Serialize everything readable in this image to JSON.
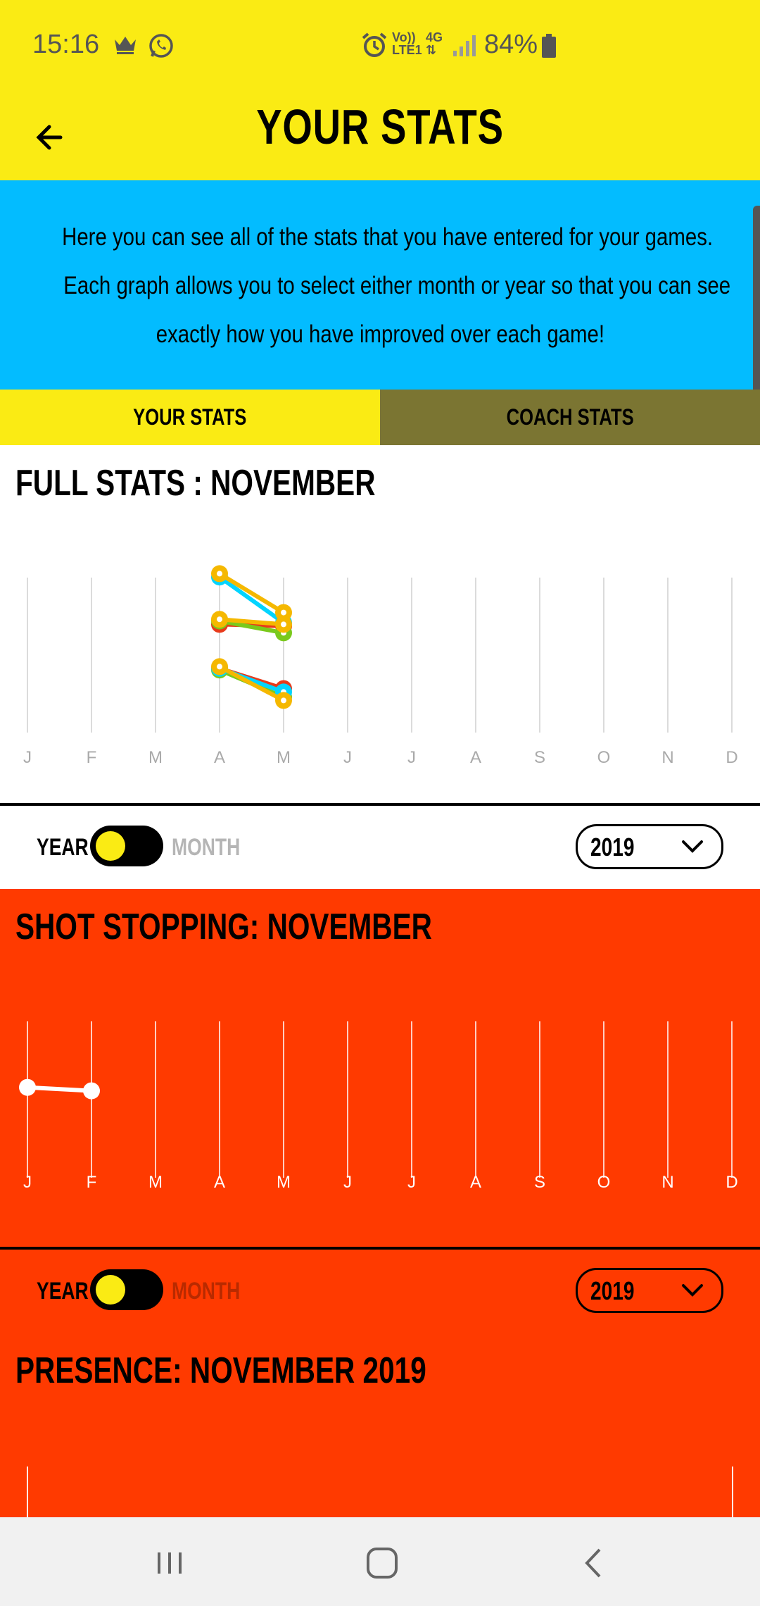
{
  "status_bar": {
    "time": "15:16",
    "icons": [
      "crown-icon",
      "whatsapp-icon",
      "alarm-icon",
      "volte-icon",
      "4g-icon",
      "signal-icon",
      "battery-icon"
    ],
    "volte_line1": "Vo))",
    "volte_line2": "LTE1",
    "network": "4G",
    "battery": "84%"
  },
  "app_bar": {
    "title": "YOUR STATS",
    "back_icon": "arrow-left-icon"
  },
  "info": {
    "line1": "Here you can see all of the stats that you have entered for your games.",
    "line2": "Each graph allows you to select either month or year so that you can see",
    "line3": "exactly how you have improved over each game!"
  },
  "tabs": [
    {
      "label": "YOUR STATS",
      "active": true
    },
    {
      "label": "COACH STATS",
      "active": false
    }
  ],
  "colors": {
    "yellow": "#faeb14",
    "blue": "#03bcff",
    "olive": "#7b7532",
    "orange": "#ff3a00"
  },
  "sections": {
    "full": {
      "title": "FULL STATS : NOVEMBER",
      "controls": {
        "year_label": "YEAR",
        "month_label": "MONTH",
        "year_value": "2019"
      }
    },
    "shot": {
      "title": "SHOT STOPPING: NOVEMBER",
      "controls": {
        "year_label": "YEAR",
        "month_label": "MONTH",
        "year_value": "2019"
      }
    },
    "presence": {
      "title": "PRESENCE: NOVEMBER 2019"
    }
  },
  "chart_data": [
    {
      "type": "line",
      "title": "FULL STATS : NOVEMBER",
      "categories": [
        "J",
        "F",
        "M",
        "A",
        "M",
        "J",
        "J",
        "A",
        "S",
        "O",
        "N",
        "D"
      ],
      "grid": "vertical",
      "ylim": [
        0,
        10
      ],
      "series": [
        {
          "color": "#03d4ff",
          "values": [
            null,
            null,
            null,
            9.2,
            6.5,
            null,
            null,
            null,
            null,
            null,
            null,
            null
          ]
        },
        {
          "color": "#f5b800",
          "values": [
            null,
            null,
            null,
            9.4,
            7.1,
            null,
            null,
            null,
            null,
            null,
            null,
            null
          ]
        },
        {
          "color": "#e83a1a",
          "values": [
            null,
            null,
            null,
            6.4,
            6.3,
            null,
            null,
            null,
            null,
            null,
            null,
            null
          ]
        },
        {
          "color": "#7ac91c",
          "values": [
            null,
            null,
            null,
            6.6,
            5.9,
            null,
            null,
            null,
            null,
            null,
            null,
            null
          ]
        },
        {
          "color": "#f5b800",
          "values": [
            null,
            null,
            null,
            6.7,
            6.4,
            null,
            null,
            null,
            null,
            null,
            null,
            null
          ]
        },
        {
          "color": "#e83a1a",
          "values": [
            null,
            null,
            null,
            3.8,
            2.6,
            null,
            null,
            null,
            null,
            null,
            null,
            null
          ]
        },
        {
          "color": "#7ac91c",
          "values": [
            null,
            null,
            null,
            3.7,
            2.1,
            null,
            null,
            null,
            null,
            null,
            null,
            null
          ]
        },
        {
          "color": "#03d4ff",
          "values": [
            null,
            null,
            null,
            3.8,
            2.4,
            null,
            null,
            null,
            null,
            null,
            null,
            null
          ]
        },
        {
          "color": "#f5b800",
          "values": [
            null,
            null,
            null,
            3.9,
            1.9,
            null,
            null,
            null,
            null,
            null,
            null,
            null
          ]
        }
      ]
    },
    {
      "type": "line",
      "title": "SHOT STOPPING: NOVEMBER",
      "categories": [
        "J",
        "F",
        "M",
        "A",
        "M",
        "J",
        "J",
        "A",
        "S",
        "O",
        "N",
        "D"
      ],
      "grid": "vertical",
      "ylim": [
        0,
        10
      ],
      "series": [
        {
          "color": "#ffffff",
          "values": [
            5.3,
            5.1,
            null,
            null,
            null,
            null,
            null,
            null,
            null,
            null,
            null,
            null
          ]
        }
      ]
    }
  ]
}
